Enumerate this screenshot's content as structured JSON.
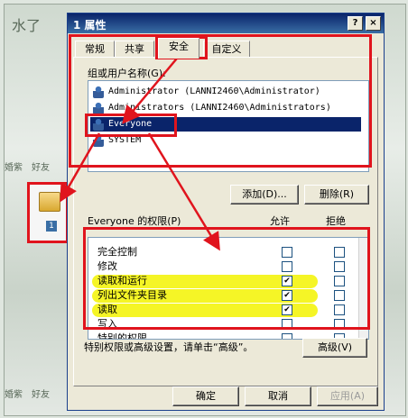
{
  "background": {
    "captions": [
      "水了",
      "好友",
      "好友",
      "好友",
      "好友"
    ],
    "desktop_labels": [
      "婚紫",
      "好友",
      "婚紫",
      "好友",
      "婚紫",
      "好友"
    ]
  },
  "window": {
    "title": "1 属性",
    "help_label": "?",
    "close_label": "×"
  },
  "tabs": [
    {
      "label": "常规"
    },
    {
      "label": "共享"
    },
    {
      "label": "安全",
      "active": true
    },
    {
      "label": "自定义"
    }
  ],
  "security": {
    "group_label": "组或用户名称(G):",
    "users": [
      {
        "name": "Administrator (LANNI2460\\Administrator)"
      },
      {
        "name": "Administrators (LANNI2460\\Administrators)"
      },
      {
        "name": "Everyone",
        "selected": true
      },
      {
        "name": "SYSTEM"
      }
    ],
    "add_button": "添加(D)...",
    "remove_button": "删除(R)",
    "perm_label": "Everyone 的权限(P)",
    "allow_header": "允许",
    "deny_header": "拒绝",
    "permissions": [
      {
        "name": "完全控制",
        "allow": false,
        "deny": false
      },
      {
        "name": "修改",
        "allow": false,
        "deny": false
      },
      {
        "name": "读取和运行",
        "allow": true,
        "deny": false
      },
      {
        "name": "列出文件夹目录",
        "allow": true,
        "deny": false
      },
      {
        "name": "读取",
        "allow": true,
        "deny": false
      },
      {
        "name": "写入",
        "allow": false,
        "deny": false
      },
      {
        "name": "特别的权限",
        "allow": false,
        "deny": false
      }
    ],
    "advanced_hint": "特别权限或高级设置，请单击“高级”。",
    "advanced_button": "高级(V)"
  },
  "buttons": {
    "ok": "确定",
    "cancel": "取消",
    "apply": "应用(A)"
  },
  "folder": {
    "label": "1"
  },
  "colors": {
    "highlight": "#e0141d",
    "marker": "#f3f300",
    "selection": "#0a246a"
  }
}
